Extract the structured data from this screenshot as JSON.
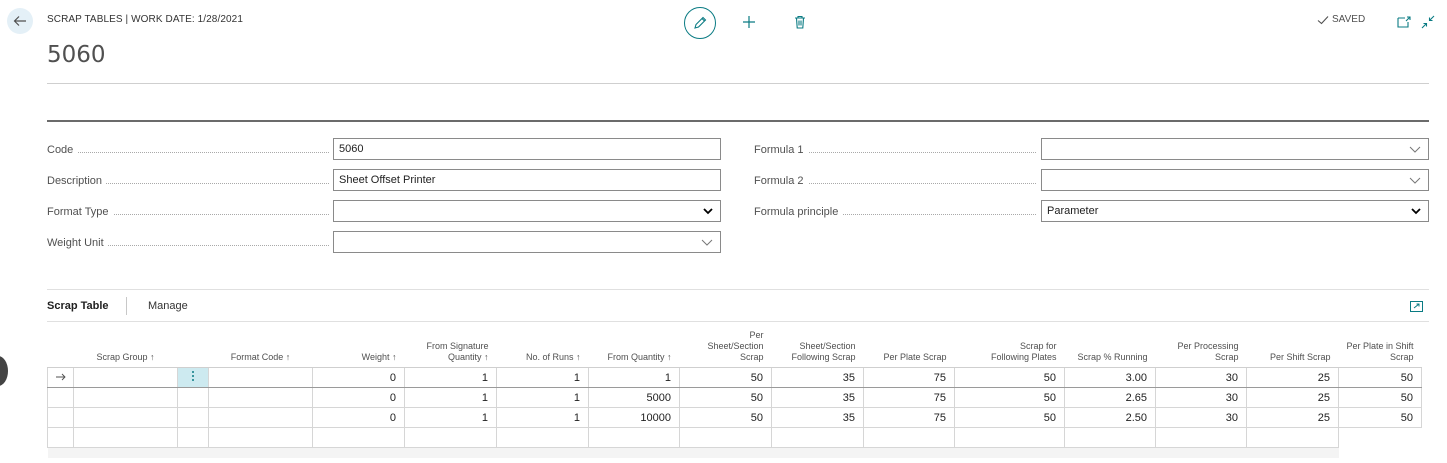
{
  "header": {
    "breadcrumb": "SCRAP TABLES | WORK DATE: 1/28/2021",
    "title": "5060",
    "status": "SAVED",
    "icons": [
      "back-arrow-icon",
      "pencil-icon",
      "plus-icon",
      "trash-icon",
      "checkmark-icon",
      "open-new-window-icon",
      "collapse-icon"
    ],
    "accent_color": "#0a7b83"
  },
  "form": {
    "code": {
      "label": "Code",
      "value": "5060"
    },
    "description": {
      "label": "Description",
      "value": "Sheet Offset Printer"
    },
    "format_type": {
      "label": "Format Type",
      "value": ""
    },
    "weight_unit": {
      "label": "Weight Unit",
      "value": ""
    },
    "formula1": {
      "label": "Formula 1",
      "value": ""
    },
    "formula2": {
      "label": "Formula 2",
      "value": ""
    },
    "formula_principle": {
      "label": "Formula principle",
      "value": "Parameter"
    }
  },
  "tabs": {
    "active": "Scrap Table",
    "manage": "Manage"
  },
  "table": {
    "columns": [
      {
        "l1": "",
        "l2": "Scrap Group ↑"
      },
      {
        "l1": "",
        "l2": "Format Code ↑"
      },
      {
        "l1": "",
        "l2": "Weight ↑"
      },
      {
        "l1": "From Signature",
        "l2": "Quantity ↑"
      },
      {
        "l1": "",
        "l2": "No. of Runs ↑"
      },
      {
        "l1": "",
        "l2": "From Quantity ↑"
      },
      {
        "l0": "Per",
        "l1": "Sheet/Section",
        "l2": "Scrap"
      },
      {
        "l1": "Sheet/Section",
        "l2": "Following Scrap"
      },
      {
        "l1": "",
        "l2": "Per Plate Scrap"
      },
      {
        "l1": "Scrap for",
        "l2": "Following Plates"
      },
      {
        "l1": "",
        "l2": "Scrap % Running"
      },
      {
        "l1": "Per Processing",
        "l2": "Scrap"
      },
      {
        "l1": "",
        "l2": "Per Shift Scrap"
      },
      {
        "l1": "Per Plate in Shift",
        "l2": "Scrap"
      }
    ],
    "rows": [
      [
        "",
        "",
        "0",
        "1",
        "1",
        "1",
        "50",
        "35",
        "75",
        "50",
        "3.00",
        "30",
        "25",
        "50"
      ],
      [
        "",
        "",
        "0",
        "1",
        "1",
        "5000",
        "50",
        "35",
        "75",
        "50",
        "2.65",
        "30",
        "25",
        "50"
      ],
      [
        "",
        "",
        "0",
        "1",
        "1",
        "10000",
        "50",
        "35",
        "75",
        "50",
        "2.50",
        "30",
        "25",
        "50"
      ]
    ]
  }
}
